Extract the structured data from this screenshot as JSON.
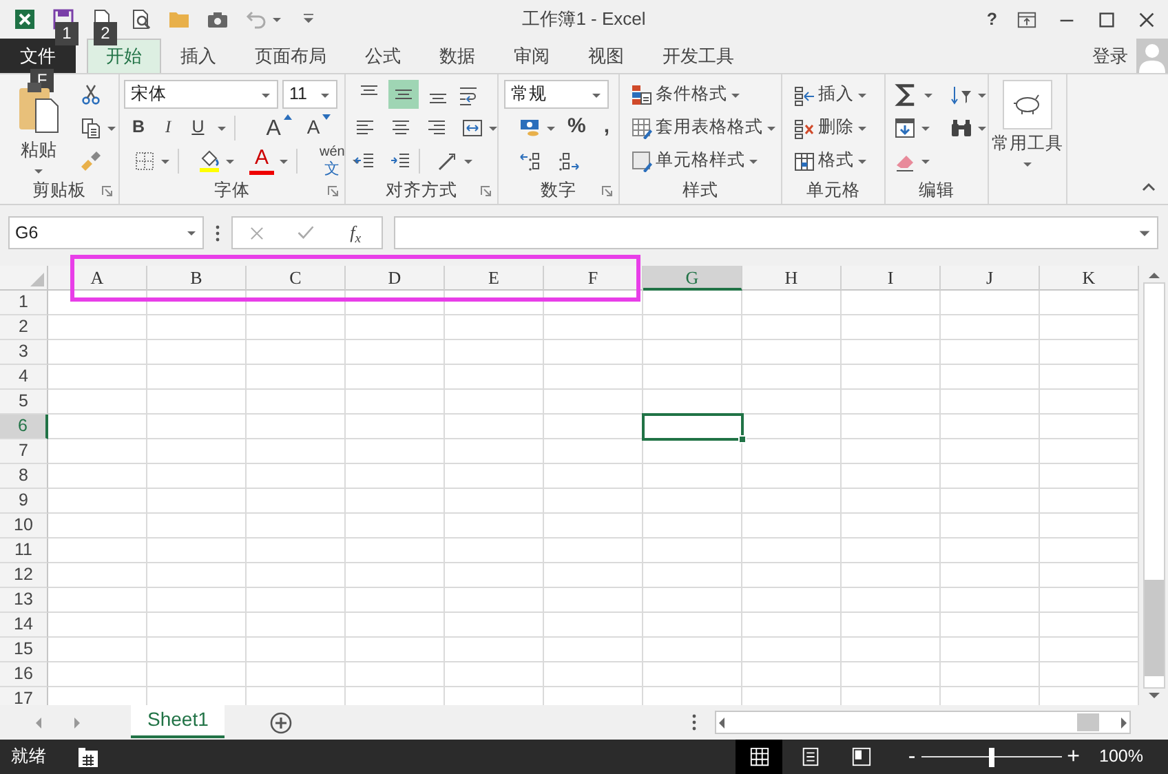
{
  "title_bar": {
    "title": "工作簿1 - Excel",
    "help": "?"
  },
  "keytips": [
    "1",
    "2",
    "F"
  ],
  "tabs": [
    {
      "label": "文件",
      "kind": "file",
      "selected": false
    },
    {
      "label": "开始",
      "kind": "tab",
      "selected": true
    },
    {
      "label": "插入",
      "kind": "tab",
      "selected": false
    },
    {
      "label": "页面布局",
      "kind": "tab",
      "selected": false
    },
    {
      "label": "公式",
      "kind": "tab",
      "selected": false
    },
    {
      "label": "数据",
      "kind": "tab",
      "selected": false
    },
    {
      "label": "审阅",
      "kind": "tab",
      "selected": false
    },
    {
      "label": "视图",
      "kind": "tab",
      "selected": false
    },
    {
      "label": "开发工具",
      "kind": "tab",
      "selected": false
    }
  ],
  "sign_in": "登录",
  "ribbon": {
    "clipboard": {
      "label": "剪贴板",
      "paste": "粘贴"
    },
    "font": {
      "label": "字体",
      "font_name": "宋体",
      "font_size": "11",
      "style_buttons": [
        "B",
        "I",
        "U"
      ],
      "size_buttons": [
        "A",
        "A"
      ],
      "font_color_button": "A",
      "phonetic": [
        "wén",
        "文"
      ]
    },
    "alignment": {
      "label": "对齐方式",
      "vertical_align": [
        {
          "selected": false
        },
        {
          "selected": true
        },
        {
          "selected": false
        }
      ]
    },
    "number": {
      "label": "数字",
      "format": "常规",
      "buttons": [
        "%",
        ","
      ]
    },
    "styles": {
      "label": "样式",
      "items": [
        "条件格式",
        "套用表格格式",
        "单元格样式"
      ]
    },
    "cells": {
      "label": "单元格",
      "items": [
        "插入",
        "删除",
        "格式"
      ]
    },
    "editing": {
      "label": "编辑"
    },
    "tools": {
      "label": "常用工具"
    }
  },
  "formula_bar": {
    "name_box": "G6",
    "function_button": "f$_{x}$"
  },
  "highlight_box": {
    "kind": "rectangle"
  },
  "sheet": {
    "columns": [
      {
        "label": "A",
        "selected": false
      },
      {
        "label": "B",
        "selected": false
      },
      {
        "label": "C",
        "selected": false
      },
      {
        "label": "D",
        "selected": false
      },
      {
        "label": "E",
        "selected": false
      },
      {
        "label": "F",
        "selected": false
      },
      {
        "label": "G",
        "selected": true
      },
      {
        "label": "H",
        "selected": false
      },
      {
        "label": "I",
        "selected": false
      },
      {
        "label": "J",
        "selected": false
      },
      {
        "label": "K",
        "selected": false
      }
    ],
    "rows": [
      {
        "label": "1",
        "selected": false
      },
      {
        "label": "2",
        "selected": false
      },
      {
        "label": "3",
        "selected": false
      },
      {
        "label": "4",
        "selected": false
      },
      {
        "label": "5",
        "selected": false
      },
      {
        "label": "6",
        "selected": true
      },
      {
        "label": "7",
        "selected": false
      },
      {
        "label": "8",
        "selected": false
      },
      {
        "label": "9",
        "selected": false
      },
      {
        "label": "10",
        "selected": false
      },
      {
        "label": "11",
        "selected": false
      },
      {
        "label": "12",
        "selected": false
      },
      {
        "label": "13",
        "selected": false
      },
      {
        "label": "14",
        "selected": false
      },
      {
        "label": "15",
        "selected": false
      },
      {
        "label": "16",
        "selected": false
      },
      {
        "label": "17",
        "selected": false
      }
    ]
  },
  "sheet_tabs": [
    {
      "label": "Sheet1",
      "selected": true
    }
  ],
  "status_bar": {
    "text": "就绪",
    "views": [
      {
        "kind": "normal",
        "selected": true
      },
      {
        "kind": "page_layout",
        "selected": false
      },
      {
        "kind": "page_break",
        "selected": false
      }
    ],
    "zoom": {
      "minus": "-",
      "plus": "+",
      "level": 0.5,
      "reading": "100%"
    }
  }
}
